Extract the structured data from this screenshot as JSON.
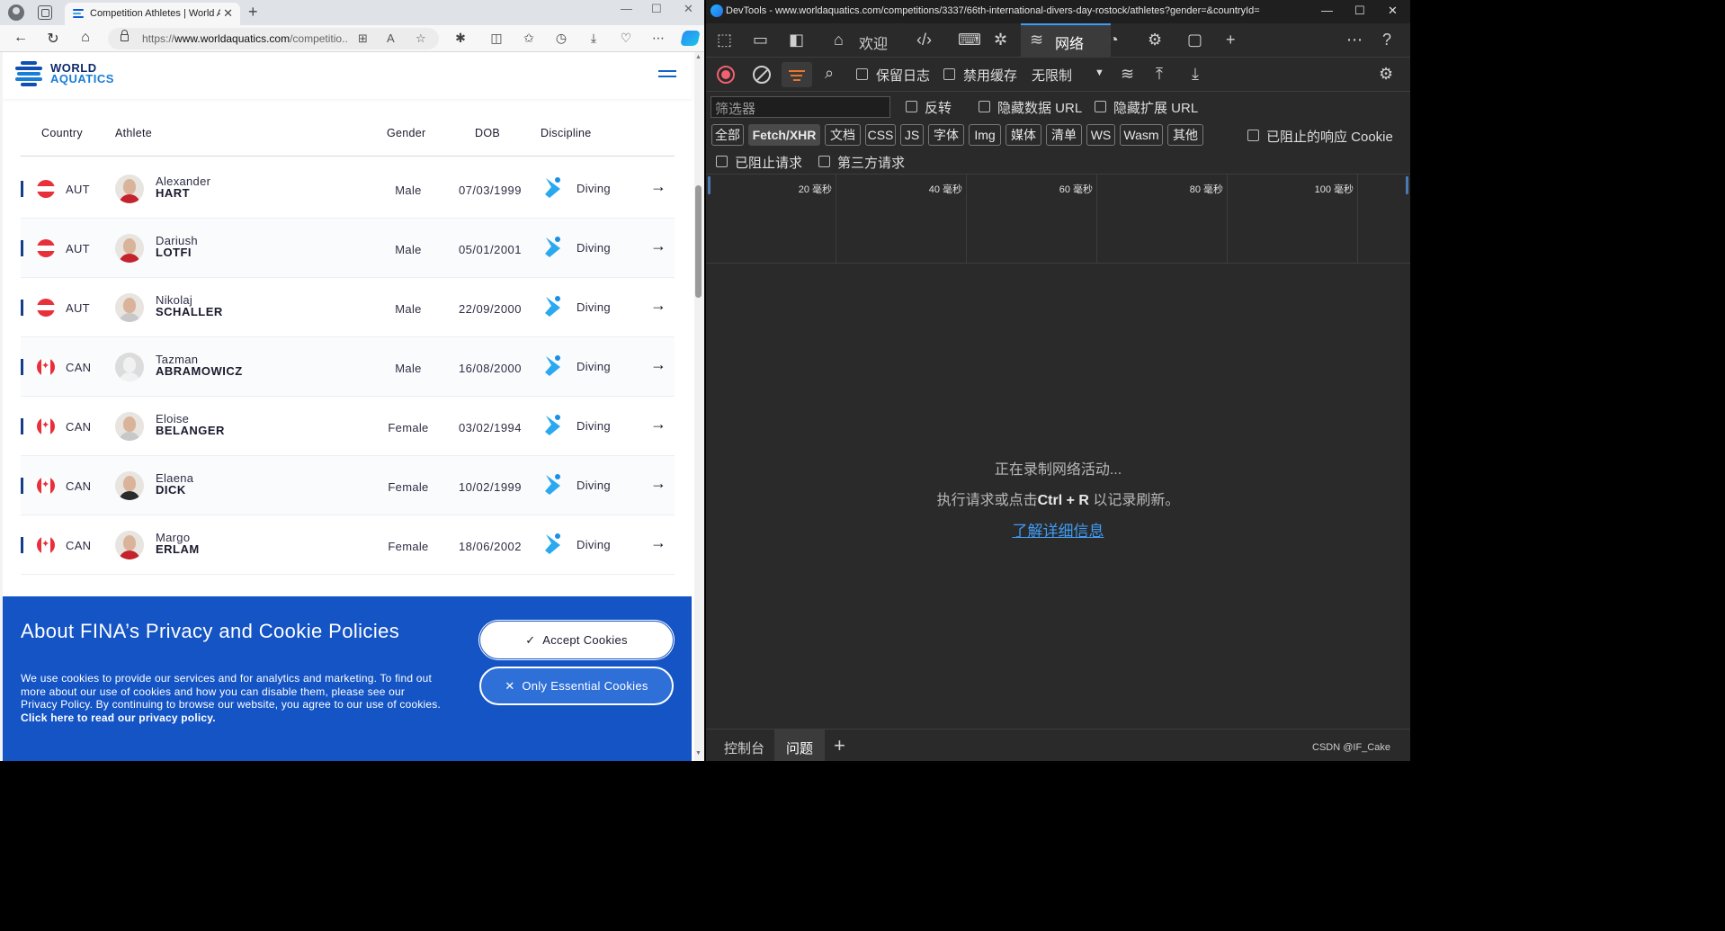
{
  "browser": {
    "tab_title": "Competition Athletes | World Aq",
    "url_prefix": "https://",
    "url_domain": "www.worldaquatics.com",
    "url_rest": "/competitio..."
  },
  "site": {
    "logo_line1": "WORLD",
    "logo_line2": "AQUATICS"
  },
  "table": {
    "headers": {
      "country": "Country",
      "athlete": "Athlete",
      "gender": "Gender",
      "dob": "DOB",
      "discipline": "Discipline"
    },
    "rows": [
      {
        "flag": "aut",
        "country": "AUT",
        "first": "Alexander",
        "last": "HART",
        "gender": "Male",
        "dob": "07/03/1999",
        "discipline": "Diving",
        "avatar": "red"
      },
      {
        "flag": "aut",
        "country": "AUT",
        "first": "Dariush",
        "last": "LOTFI",
        "gender": "Male",
        "dob": "05/01/2001",
        "discipline": "Diving",
        "avatar": "red"
      },
      {
        "flag": "aut",
        "country": "AUT",
        "first": "Nikolaj",
        "last": "SCHALLER",
        "gender": "Male",
        "dob": "22/09/2000",
        "discipline": "Diving",
        "avatar": "plain"
      },
      {
        "flag": "can",
        "country": "CAN",
        "first": "Tazman",
        "last": "ABRAMOWICZ",
        "gender": "Male",
        "dob": "16/08/2000",
        "discipline": "Diving",
        "avatar": "blank"
      },
      {
        "flag": "can",
        "country": "CAN",
        "first": "Eloise",
        "last": "BELANGER",
        "gender": "Female",
        "dob": "03/02/1994",
        "discipline": "Diving",
        "avatar": "plain"
      },
      {
        "flag": "can",
        "country": "CAN",
        "first": "Elaena",
        "last": "DICK",
        "gender": "Female",
        "dob": "10/02/1999",
        "discipline": "Diving",
        "avatar": "dark"
      },
      {
        "flag": "can",
        "country": "CAN",
        "first": "Margo",
        "last": "ERLAM",
        "gender": "Female",
        "dob": "18/06/2002",
        "discipline": "Diving",
        "avatar": "red"
      }
    ]
  },
  "cookie": {
    "title": "About FINA’s Privacy and Cookie Policies",
    "body": "We use cookies to provide our services and for analytics and marketing. To find out more about our use of cookies and how you can disable them, please see our Privacy Policy. By continuing to browse our website, you agree to our use of cookies.",
    "link": "Click here to read our privacy policy.",
    "accept_label": "Accept Cookies",
    "essential_label": "Only Essential Cookies"
  },
  "devtools": {
    "title": "DevTools - www.worldaquatics.com/competitions/3337/66th-international-divers-day-rostock/athletes?gender=&countryId=",
    "tabs": {
      "welcome": "欢迎",
      "network": "网络"
    },
    "toolbar": {
      "preserve_log": "保留日志",
      "disable_cache": "禁用缓存",
      "throttle": "无限制"
    },
    "filter": {
      "placeholder": "筛选器",
      "invert": "反转",
      "hide_data_urls": "隐藏数据 URL",
      "hide_ext_urls": "隐藏扩展 URL"
    },
    "types": [
      "全部",
      "Fetch/XHR",
      "文档",
      "CSS",
      "JS",
      "字体",
      "Img",
      "媒体",
      "清单",
      "WS",
      "Wasm",
      "其他"
    ],
    "blocked_cookies": "已阻止的响应 Cookie",
    "blocked_requests": "已阻止请求",
    "third_party": "第三方请求",
    "timeline": [
      "20 毫秒",
      "40 毫秒",
      "60 毫秒",
      "80 毫秒",
      "100 毫秒"
    ],
    "empty": {
      "line1": "正在录制网络活动...",
      "line2_pre": "执行请求或点击",
      "line2_key": "Ctrl + R",
      "line2_post": " 以记录刷新。",
      "link": "了解详细信息"
    },
    "drawer": {
      "console": "控制台",
      "issues": "问题"
    },
    "watermark": "CSDN @IF_Cake"
  }
}
